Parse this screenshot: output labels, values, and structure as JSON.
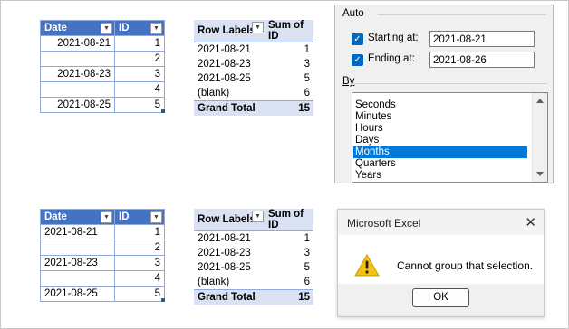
{
  "example1": {
    "source": {
      "headers": {
        "date": "Date",
        "id": "ID"
      },
      "rows": [
        {
          "date": "2021-08-21",
          "id": "1"
        },
        {
          "date": "",
          "id": "2"
        },
        {
          "date": "2021-08-23",
          "id": "3"
        },
        {
          "date": "",
          "id": "4"
        },
        {
          "date": "2021-08-25",
          "id": "5"
        }
      ]
    },
    "pivot": {
      "headers": {
        "labels": "Row Labels",
        "sum": "Sum of ID"
      },
      "rows": [
        {
          "label": "2021-08-21",
          "sum": "1"
        },
        {
          "label": "2021-08-23",
          "sum": "3"
        },
        {
          "label": "2021-08-25",
          "sum": "5"
        },
        {
          "label": "(blank)",
          "sum": "6"
        }
      ],
      "total": {
        "label": "Grand Total",
        "sum": "15"
      }
    }
  },
  "example2": {
    "source": {
      "headers": {
        "date": "Date",
        "id": "ID"
      },
      "rows": [
        {
          "date": "2021-08-21",
          "id": "1"
        },
        {
          "date": "",
          "id": "2"
        },
        {
          "date": "2021-08-23",
          "id": "3"
        },
        {
          "date": "",
          "id": "4"
        },
        {
          "date": "2021-08-25",
          "id": "5"
        }
      ]
    },
    "pivot": {
      "headers": {
        "labels": "Row Labels",
        "sum": "Sum of ID"
      },
      "rows": [
        {
          "label": "2021-08-21",
          "sum": "1"
        },
        {
          "label": "2021-08-23",
          "sum": "3"
        },
        {
          "label": "2021-08-25",
          "sum": "5"
        },
        {
          "label": "(blank)",
          "sum": "6"
        }
      ],
      "total": {
        "label": "Grand Total",
        "sum": "15"
      }
    }
  },
  "grouping_dialog": {
    "auto_label": "Auto",
    "starting_label": "Starting at:",
    "starting_value": "2021-08-21",
    "starting_checked": true,
    "ending_label": "Ending at:",
    "ending_value": "2021-08-26",
    "ending_checked": true,
    "by_label": "By",
    "options": [
      "Seconds",
      "Minutes",
      "Hours",
      "Days",
      "Months",
      "Quarters",
      "Years"
    ],
    "selected": "Months"
  },
  "message_box": {
    "title": "Microsoft Excel",
    "message": "Cannot group that selection.",
    "ok_label": "OK",
    "icon": "warning-icon",
    "close_icon": "close-icon"
  },
  "colors": {
    "table_header": "#4472c4",
    "table_border": "#8eaadb",
    "pivot_header": "#d9e1f2",
    "selection": "#0078d7",
    "warning": "#f5c211"
  }
}
